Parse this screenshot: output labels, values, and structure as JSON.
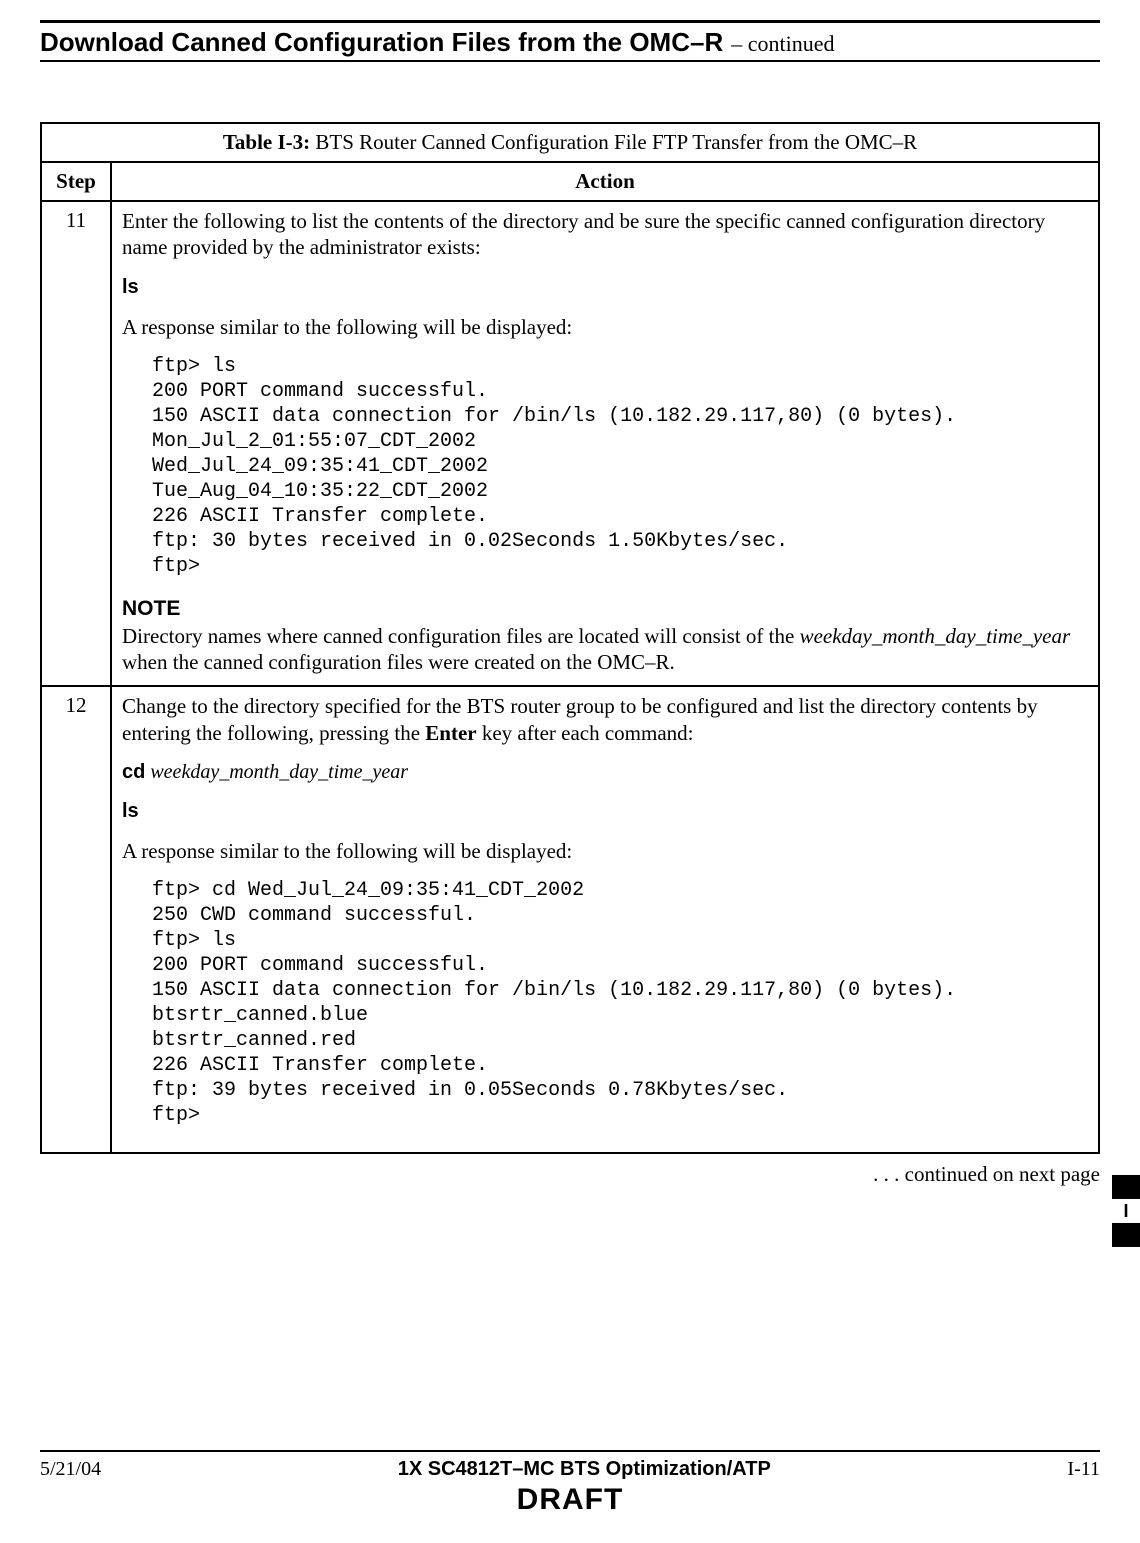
{
  "header": {
    "title_main": "Download Canned Configuration Files from the OMC–R",
    "title_cont": "– continued"
  },
  "table": {
    "title_label": "Table I-3:",
    "title_text": " BTS Router Canned Configuration File FTP Transfer from the OMC–R",
    "col_step": "Step",
    "col_action": "Action",
    "rows": [
      {
        "step": "11",
        "p1": "Enter the following to list the contents of the directory and be sure the specific canned configuration directory name provided by the administrator exists:",
        "cmd1": "ls",
        "p2": "A response similar to the following will be displayed:",
        "mono": "ftp> ls\n200 PORT command successful.\n150 ASCII data connection for /bin/ls (10.182.29.117,80) (0 bytes).\nMon_Jul_2_01:55:07_CDT_2002\nWed_Jul_24_09:35:41_CDT_2002\nTue_Aug_04_10:35:22_CDT_2002\n226 ASCII Transfer complete.\nftp: 30 bytes received in 0.02Seconds 1.50Kbytes/sec.\nftp>",
        "note_hdr": "NOTE",
        "note_pre": "Directory names where canned configuration files are located will consist of the ",
        "note_italic": "weekday_month_day_time_year",
        "note_post": " when the canned configuration files were created on the OMC–R."
      },
      {
        "step": "12",
        "p1_pre": "Change to the directory specified for the BTS router group to be configured and list the directory contents by entering the following, pressing the ",
        "p1_bold": "Enter",
        "p1_post": " key after each command:",
        "cmd1": "cd",
        "cmd1_arg": "  weekday_month_day_time_year",
        "cmd2": "ls",
        "p2": "A response similar to the following will be displayed:",
        "mono": "ftp> cd Wed_Jul_24_09:35:41_CDT_2002\n250 CWD command successful.\nftp> ls\n200 PORT command successful.\n150 ASCII data connection for /bin/ls (10.182.29.117,80) (0 bytes).\nbtsrtr_canned.blue\nbtsrtr_canned.red\n226 ASCII Transfer complete.\nftp: 39 bytes received in 0.05Seconds 0.78Kbytes/sec.\nftp>"
      }
    ]
  },
  "continued": " . . . continued on next page",
  "side_tab": "I",
  "footer": {
    "date": "5/21/04",
    "doc": "1X SC4812T–MC BTS Optimization/ATP",
    "page": "I-11",
    "draft": "DRAFT"
  }
}
